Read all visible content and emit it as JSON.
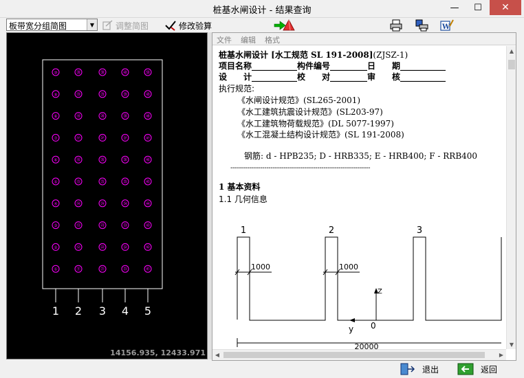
{
  "window": {
    "title": "桩基水闸设计 - 结果查询",
    "min_label": "—",
    "max_label": "☐",
    "close_label": "✕"
  },
  "toolbar": {
    "combo_value": "板带宽分组简图",
    "adjust_label": "调整简图",
    "edit_label": "修改验算",
    "icons": [
      "nav-arrow-icon",
      "cone-icon",
      "print-icon",
      "print-setup-icon",
      "word-export-icon"
    ]
  },
  "drawing": {
    "columns": [
      "1",
      "2",
      "3",
      "4",
      "5"
    ],
    "pile_rows": [
      [
        "⑩",
        "⑳",
        "㉚",
        "㊵",
        "㊿"
      ],
      [
        "⑨",
        "⑲",
        "㉙",
        "㊴",
        "㊾"
      ],
      [
        "⑧",
        "⑱",
        "㉘",
        "㊳",
        "㊽"
      ],
      [
        "⑦",
        "⑰",
        "㉗",
        "㊲",
        "㊼"
      ],
      [
        "⑥",
        "⑯",
        "㉖",
        "㊱",
        "㊻"
      ],
      [
        "⑤",
        "⑮",
        "㉕",
        "㉟",
        "㊺"
      ],
      [
        "④",
        "⑭",
        "㉔",
        "㉞",
        "㊹"
      ],
      [
        "③",
        "⑬",
        "㉓",
        "㉝",
        "㊸"
      ],
      [
        "②",
        "⑫",
        "㉒",
        "㉜",
        "㊷"
      ],
      [
        "①",
        "⑪",
        "㉑",
        "㉛",
        "㊶"
      ]
    ],
    "coordinate": "14156.935, 12433.971",
    "pile_color": "#ff00ff"
  },
  "menu": {
    "file": "文件",
    "edit": "编辑",
    "format": "格式"
  },
  "report": {
    "heading_bold": "桩基水闸设计 [水工规范 SL 191-2008]",
    "heading_code": "(ZJSZ-1)",
    "row1": "项目名称___________构件编号_________日　　期___________",
    "row2": "设　　计___________校　　对_________审　　核___________",
    "spec_title": "执行规范:",
    "specs": [
      "《水闸设计规范》(SL265-2001)",
      "《水工建筑抗震设计规范》(SL203-97)",
      "《水工建筑物荷载规范》(DL 5077-1997)",
      "《水工混凝土结构设计规范》(SL 191-2008)"
    ],
    "rebar": "钢筋: d - HPB235; D - HRB335; E - HRB400; F - RRB400",
    "divider": "------------------------------------------------------------------",
    "section1": "1  基本资料",
    "section11": "1.1  几何信息"
  },
  "diagram": {
    "label1": "1",
    "label2": "2",
    "label3": "3",
    "dim1": "1000",
    "dim2": "1000",
    "axis_z": "Z",
    "axis_y": "y",
    "origin": "0",
    "total": "20000"
  },
  "bottom": {
    "exit_label": "退出",
    "back_label": "返回"
  }
}
